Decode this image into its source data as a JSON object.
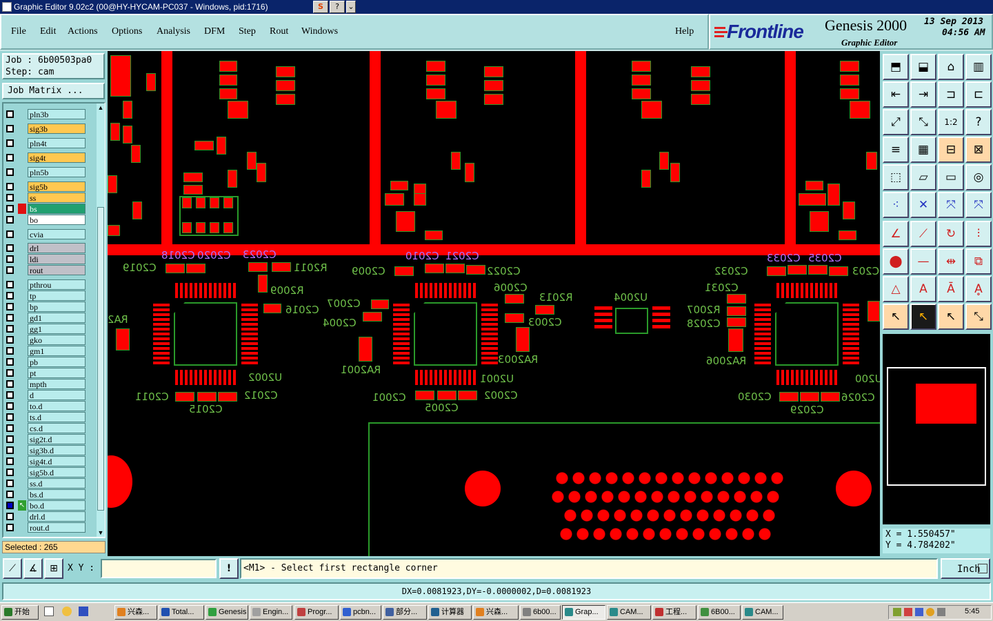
{
  "title": "Graphic Editor 9.02c2 (00@HY-HYCAM-PC037 - Windows, pid:1716)",
  "title_buttons": [
    "S",
    "?",
    "⌄"
  ],
  "menu": [
    "File",
    "Edit",
    "Actions",
    "Options",
    "Analysis",
    "DFM",
    "Step",
    "Rout",
    "Windows"
  ],
  "help": "Help",
  "brand": {
    "logo": "Frontline",
    "product": "Genesis 2000",
    "subtitle": "Graphic Editor",
    "date": "13 Sep 2013",
    "time": "04:56 AM"
  },
  "job": "Job : 6b00503pa0",
  "step": "Step: cam",
  "job_matrix": "Job Matrix ...",
  "layers": [
    {
      "name": "pln3b",
      "color": "#b8ecec"
    },
    {
      "name": "sig3b",
      "color": "#ffc850"
    },
    {
      "name": "pln4t",
      "color": "#b8ecec"
    },
    {
      "name": "sig4t",
      "color": "#ffc850"
    },
    {
      "name": "pln5b",
      "color": "#b8ecec"
    },
    {
      "name": "sig5b",
      "color": "#ffc850"
    },
    {
      "name": "ss",
      "color": "#ffc850"
    },
    {
      "name": "bs",
      "color": "#20a070"
    },
    {
      "name": "bo",
      "color": "#ffffff"
    },
    {
      "name": "cvia",
      "color": "#b8ecec"
    },
    {
      "name": "drl",
      "color": "#c0c0c8"
    },
    {
      "name": "ldi",
      "color": "#c0c0c8"
    },
    {
      "name": "rout",
      "color": "#c0c0c8"
    },
    {
      "name": "pthrou",
      "color": "#b8ecec"
    },
    {
      "name": "tp",
      "color": "#b8ecec"
    },
    {
      "name": "bp",
      "color": "#b8ecec"
    },
    {
      "name": "gd1",
      "color": "#b8ecec"
    },
    {
      "name": "gg1",
      "color": "#b8ecec"
    },
    {
      "name": "gko",
      "color": "#b8ecec"
    },
    {
      "name": "gm1",
      "color": "#b8ecec"
    },
    {
      "name": "pb",
      "color": "#b8ecec"
    },
    {
      "name": "pt",
      "color": "#b8ecec"
    },
    {
      "name": "mpth",
      "color": "#b8ecec"
    },
    {
      "name": "d",
      "color": "#b8ecec"
    },
    {
      "name": "to.d",
      "color": "#b8ecec"
    },
    {
      "name": "ts.d",
      "color": "#b8ecec"
    },
    {
      "name": "cs.d",
      "color": "#b8ecec"
    },
    {
      "name": "sig2t.d",
      "color": "#b8ecec"
    },
    {
      "name": "sig3b.d",
      "color": "#b8ecec"
    },
    {
      "name": "sig4t.d",
      "color": "#b8ecec"
    },
    {
      "name": "sig5b.d",
      "color": "#b8ecec"
    },
    {
      "name": "ss.d",
      "color": "#b8ecec"
    },
    {
      "name": "bs.d",
      "color": "#b8ecec"
    },
    {
      "name": "bo.d",
      "color": "#b8ecec"
    },
    {
      "name": "drl.d",
      "color": "#b8ecec"
    },
    {
      "name": "rout.d",
      "color": "#b8ecec"
    }
  ],
  "selected": "Selected : 265",
  "silk_labels": [
    "C2019",
    "C2018",
    "C2020",
    "C2023",
    "R2011",
    "R2009",
    "C2016",
    "C2007",
    "C2004",
    "RA2",
    "RA2001",
    "C2009",
    "C2010",
    "C2021",
    "C2022",
    "C2006",
    "R2013",
    "C2003",
    "RA2003",
    "C2011",
    "C2015",
    "C2012",
    "U2002",
    "C2001",
    "C2005",
    "U2001",
    "C2002",
    "U2004",
    "C2032",
    "C2033",
    "C2035",
    "C2031",
    "R2007",
    "C2028",
    "RA2006",
    "C2030",
    "C2029",
    "U200",
    "C2026",
    "C203"
  ],
  "coords": {
    "x": "X  =  1.550457\"",
    "y": "Y  =  4.784202\""
  },
  "xy_label": "X Y :",
  "xy_value": "",
  "prompt": "<M1> - Select first rectangle corner",
  "unit": "Inch",
  "dx": "DX=0.0081923,DY=-0.0000002,D=0.0081923",
  "taskbar": {
    "start": "开始",
    "tasks": [
      "兴森...",
      "Total...",
      "Genesis",
      "Engin...",
      "Progr...",
      "pcbn...",
      "部分...",
      "计算器",
      "兴森...",
      "6b00...",
      "Grap...",
      "CAM...",
      "工程...",
      "6B00...",
      "CAM..."
    ],
    "clock": "5:45"
  }
}
